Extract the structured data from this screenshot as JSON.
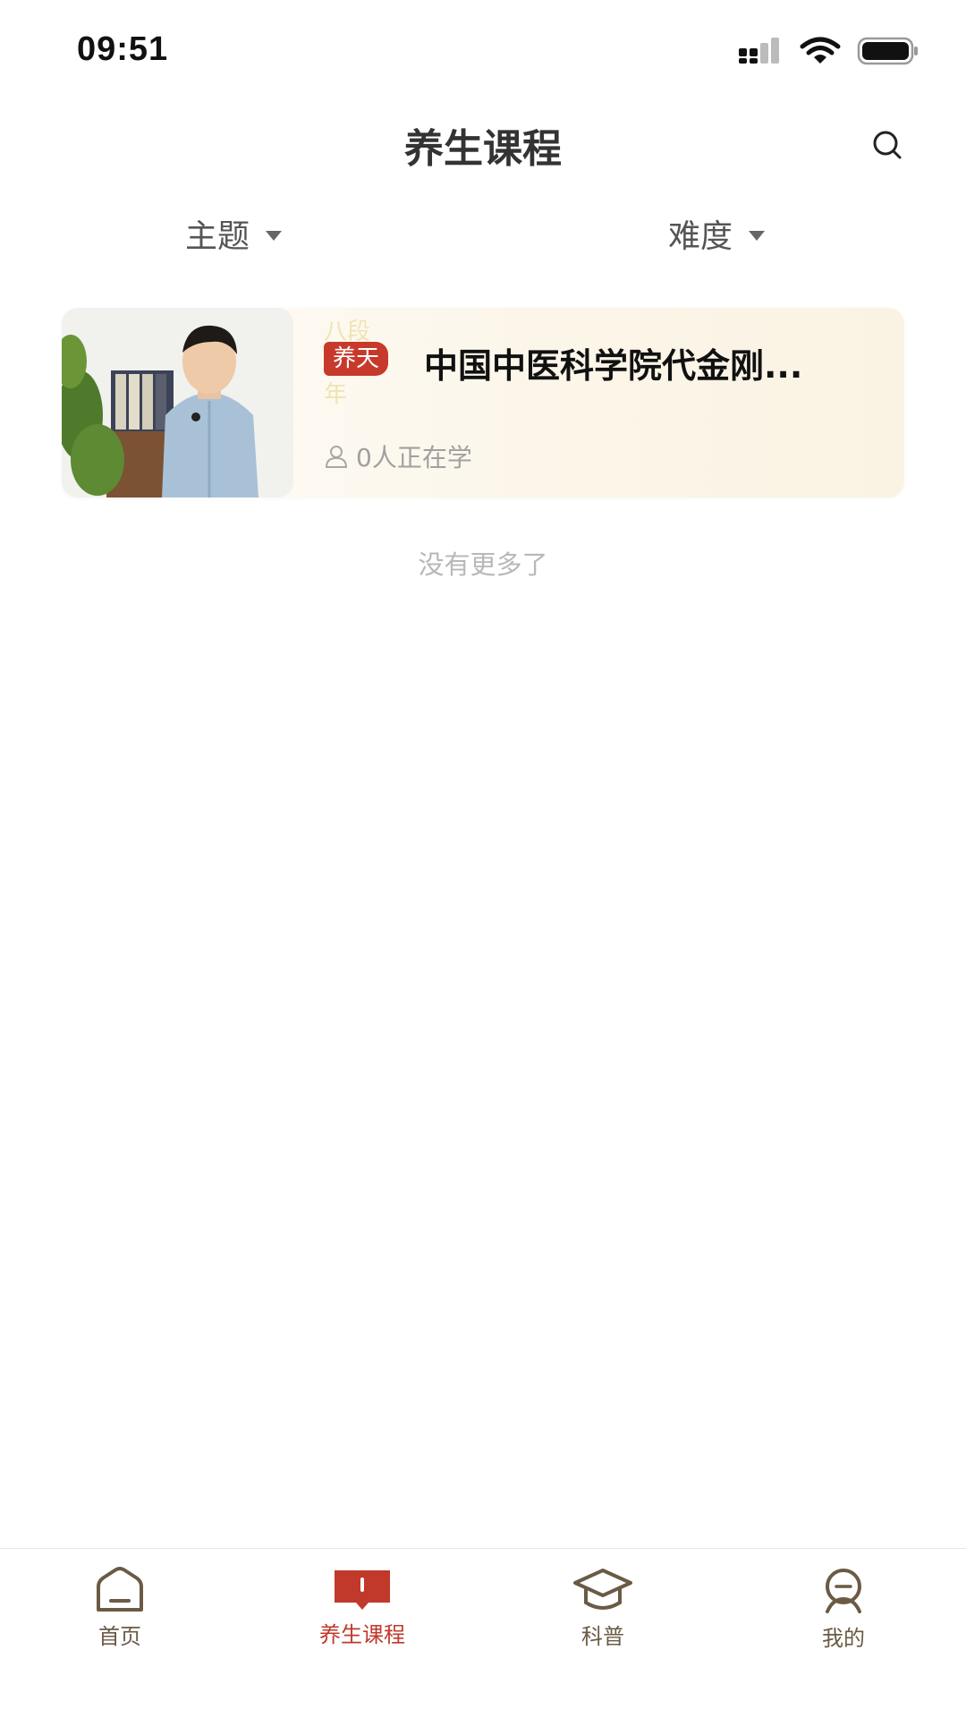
{
  "status_bar": {
    "time": "09:51"
  },
  "header": {
    "title": "养生课程",
    "search_icon": "search-icon"
  },
  "filters": [
    {
      "label": "主题"
    },
    {
      "label": "难度"
    }
  ],
  "courses": [
    {
      "tag": "养天",
      "tag_ghost_top": "八段",
      "tag_ghost_bottom": "年",
      "title": "中国中医科学院代金刚...",
      "learners": "0人正在学"
    }
  ],
  "list_end_text": "没有更多了",
  "tab_bar": {
    "items": [
      {
        "label": "首页",
        "icon": "home-icon"
      },
      {
        "label": "养生课程",
        "icon": "book-icon",
        "active": true
      },
      {
        "label": "科普",
        "icon": "graduation-cap-icon"
      },
      {
        "label": "我的",
        "icon": "profile-icon"
      }
    ]
  },
  "colors": {
    "accent": "#c0392b",
    "tab_inactive": "#6b5a44"
  }
}
